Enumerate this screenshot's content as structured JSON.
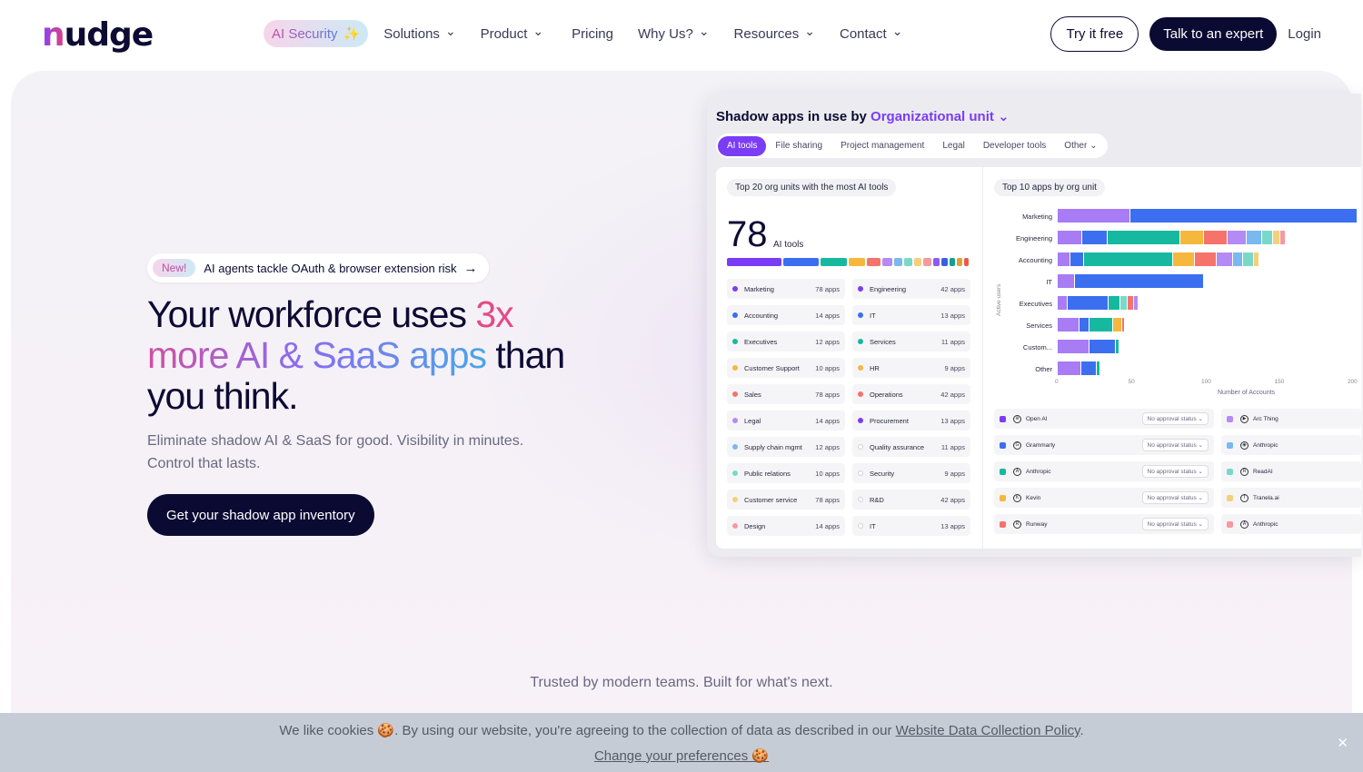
{
  "nav": {
    "logo": "nudge",
    "logo_first": "n",
    "logo_rest": "udge",
    "items": [
      {
        "label": "AI Security",
        "badge": "✨"
      },
      {
        "label": "Solutions",
        "chevron": true
      },
      {
        "label": "Product",
        "chevron": true
      },
      {
        "label": "Pricing",
        "chevron": false
      },
      {
        "label": "Why Us?",
        "chevron": true
      },
      {
        "label": "Resources",
        "chevron": true
      },
      {
        "label": "Contact",
        "chevron": true
      }
    ],
    "try_free": "Try it free",
    "talk_expert": "Talk to an expert",
    "login": "Login"
  },
  "hero": {
    "pill_new": "New!",
    "pill_text": "AI agents tackle OAuth & browser extension risk",
    "pill_arrow": "→",
    "h1_a": "Your workforce uses ",
    "h1_b": "3x",
    "h1_c": "more AI & SaaS apps",
    "h1_d": " than you think.",
    "sub": "Eliminate shadow AI & SaaS for good. Visibility in minutes. Control that lasts.",
    "cta": "Get your shadow app inventory",
    "trusted": "Trusted by modern teams. Built for what's next."
  },
  "dashboard": {
    "title_a": "Shadow apps in use by ",
    "title_b": "Organizational unit",
    "title_chev": "⌄",
    "tabs": [
      "AI tools",
      "File sharing",
      "Project management",
      "Legal",
      "Developer tools",
      "Other ⌄"
    ],
    "left_chip": "Top 20 org units with the most AI tools",
    "big_number": "78",
    "big_label": "AI tools",
    "seg_colors": [
      "#7b3cf5",
      "#3b6ff0",
      "#16b8a0",
      "#f5b83d",
      "#f5736a",
      "#b48af5",
      "#7ab8f0",
      "#7ad8c8",
      "#f5d07a",
      "#f59aa0",
      "#8a5cf5",
      "#3b5fe0",
      "#12a090",
      "#e0a030",
      "#e85a50"
    ],
    "units": [
      {
        "name": "Marketing",
        "count": "78 apps",
        "color": "#7b3cf5"
      },
      {
        "name": "Engineering",
        "count": "42 apps",
        "color": "#7b3cf5"
      },
      {
        "name": "Accounting",
        "count": "14 apps",
        "color": "#3b6ff0"
      },
      {
        "name": "IT",
        "count": "13 apps",
        "color": "#3b6ff0"
      },
      {
        "name": "Executives",
        "count": "12 apps",
        "color": "#16b8a0"
      },
      {
        "name": "Services",
        "count": "11 apps",
        "color": "#16b8a0"
      },
      {
        "name": "Customer Support",
        "count": "10 apps",
        "color": "#f5b83d"
      },
      {
        "name": "HR",
        "count": "9 apps",
        "color": "#f5b83d"
      },
      {
        "name": "Sales",
        "count": "78 apps",
        "color": "#f5736a"
      },
      {
        "name": "Operations",
        "count": "42 apps",
        "color": "#f5736a"
      },
      {
        "name": "Legal",
        "count": "14 apps",
        "color": "#b48af5"
      },
      {
        "name": "Procurement",
        "count": "13 apps",
        "color": "#7b3cf5"
      },
      {
        "name": "Supply chain mgmt",
        "count": "12 apps",
        "color": "#7ab8f0"
      },
      {
        "name": "Quality assurance",
        "count": "11 apps",
        "color": "#ffffff"
      },
      {
        "name": "Public relations",
        "count": "10 apps",
        "color": "#7ad8c8"
      },
      {
        "name": "Security",
        "count": "9 apps",
        "color": "#ffffff"
      },
      {
        "name": "Customer service",
        "count": "78 apps",
        "color": "#f5d07a"
      },
      {
        "name": "R&D",
        "count": "42 apps",
        "color": "#ffffff"
      },
      {
        "name": "Design",
        "count": "14 apps",
        "color": "#f59aa0"
      },
      {
        "name": "IT",
        "count": "13 apps",
        "color": "#ffffff"
      }
    ],
    "right_chip": "Top 10 apps by org unit",
    "chart_ylabel": "Active users",
    "chart_xlabel": "Number of Accounts",
    "x_ticks": [
      "0",
      "50",
      "100",
      "150",
      "200"
    ],
    "bars": [
      {
        "label": "Marketing",
        "segments": [
          {
            "v": 50,
            "c": "#a77cf5"
          },
          {
            "v": 155,
            "c": "#3b6ff0"
          }
        ]
      },
      {
        "label": "Engineering",
        "segments": [
          {
            "v": 17,
            "c": "#a77cf5"
          },
          {
            "v": 17,
            "c": "#3b6ff0"
          },
          {
            "v": 50,
            "c": "#16b8a0"
          },
          {
            "v": 16,
            "c": "#f5b83d"
          },
          {
            "v": 16,
            "c": "#f5736a"
          },
          {
            "v": 13,
            "c": "#b48af5"
          },
          {
            "v": 11,
            "c": "#7ab8f0"
          },
          {
            "v": 7,
            "c": "#7ad8c8"
          },
          {
            "v": 5,
            "c": "#f5d07a"
          },
          {
            "v": 4,
            "c": "#f59aa0"
          }
        ]
      },
      {
        "label": "Accounting",
        "segments": [
          {
            "v": 9,
            "c": "#a77cf5"
          },
          {
            "v": 9,
            "c": "#3b6ff0"
          },
          {
            "v": 61,
            "c": "#16b8a0"
          },
          {
            "v": 15,
            "c": "#f5b83d"
          },
          {
            "v": 15,
            "c": "#f5736a"
          },
          {
            "v": 11,
            "c": "#b48af5"
          },
          {
            "v": 7,
            "c": "#7ab8f0"
          },
          {
            "v": 7,
            "c": "#7ad8c8"
          },
          {
            "v": 4,
            "c": "#f5d07a"
          }
        ]
      },
      {
        "label": "IT",
        "segments": [
          {
            "v": 12,
            "c": "#a77cf5"
          },
          {
            "v": 88,
            "c": "#3b6ff0"
          }
        ]
      },
      {
        "label": "Executives",
        "segments": [
          {
            "v": 7,
            "c": "#a77cf5"
          },
          {
            "v": 28,
            "c": "#3b6ff0"
          },
          {
            "v": 8,
            "c": "#16b8a0"
          },
          {
            "v": 5,
            "c": "#7ad8c8"
          },
          {
            "v": 4,
            "c": "#f5736a"
          },
          {
            "v": 3,
            "c": "#b48af5"
          }
        ]
      },
      {
        "label": "Services",
        "segments": [
          {
            "v": 15,
            "c": "#a77cf5"
          },
          {
            "v": 7,
            "c": "#3b6ff0"
          },
          {
            "v": 16,
            "c": "#16b8a0"
          },
          {
            "v": 6,
            "c": "#f5b83d"
          },
          {
            "v": 2,
            "c": "#f5736a"
          }
        ]
      },
      {
        "label": "Custom...",
        "segments": [
          {
            "v": 22,
            "c": "#a77cf5"
          },
          {
            "v": 18,
            "c": "#3b6ff0"
          },
          {
            "v": 2,
            "c": "#16b8a0"
          }
        ]
      },
      {
        "label": "Other",
        "segments": [
          {
            "v": 16,
            "c": "#a77cf5"
          },
          {
            "v": 11,
            "c": "#3b6ff0"
          },
          {
            "v": 2,
            "c": "#16b8a0"
          }
        ]
      }
    ],
    "x_max": 205,
    "apps_left": [
      {
        "name": "Open AI",
        "status": "No approval status ⌄",
        "sq": "#7b3cf5",
        "icon": "⊛"
      },
      {
        "name": "Grammarly",
        "status": "No approval status ⌄",
        "sq": "#3b6ff0",
        "icon": "G"
      },
      {
        "name": "Anthropic",
        "status": "No approval status ⌄",
        "sq": "#16b8a0",
        "icon": "A"
      },
      {
        "name": "Kevin",
        "status": "No approval status ⌄",
        "sq": "#f5b83d",
        "icon": "K"
      },
      {
        "name": "Runway",
        "status": "No approval status ⌄",
        "sq": "#f5736a",
        "icon": "R"
      }
    ],
    "apps_right": [
      {
        "name": "Arc Thing",
        "sq": "#b48af5",
        "icon": "▶"
      },
      {
        "name": "Anthropic",
        "sq": "#7ab8f0",
        "icon": "◉"
      },
      {
        "name": "ReadAI",
        "sq": "#7ad8c8",
        "icon": "R"
      },
      {
        "name": "Tranela.ai",
        "sq": "#f5d07a",
        "icon": "T"
      },
      {
        "name": "Anthropic",
        "sq": "#f59aa0",
        "icon": "A"
      }
    ]
  },
  "cookie": {
    "line1_a": "We like cookies 🍪. By using our website, you're agreeing to the collection of data as described in our ",
    "line1_link": "Website Data Collection Policy",
    "line1_b": ".",
    "line2": "Change your preferences 🍪",
    "close": "✕"
  }
}
